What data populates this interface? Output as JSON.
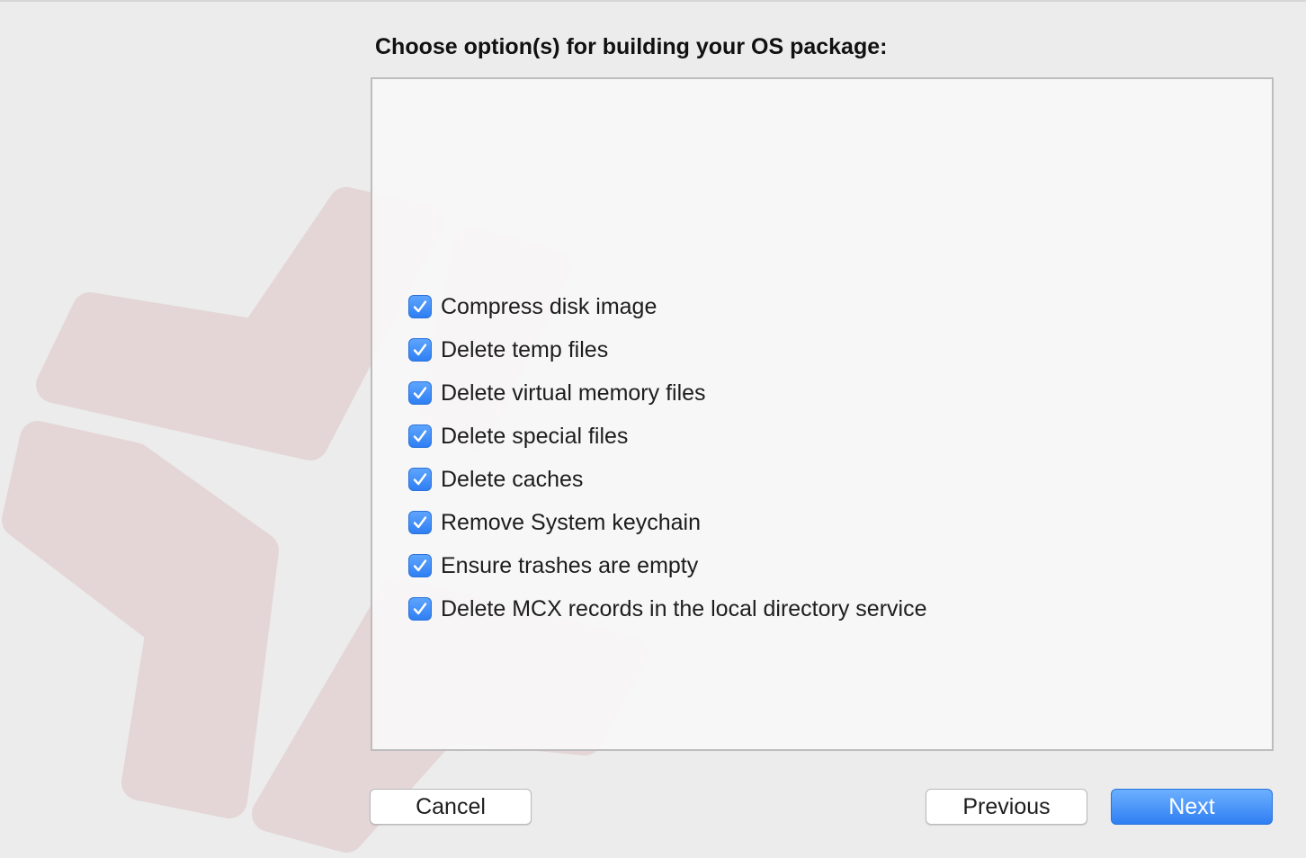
{
  "wizard": {
    "heading": "Choose option(s) for building your OS package:"
  },
  "options": [
    {
      "label": "Compress disk image",
      "checked": true
    },
    {
      "label": "Delete temp files",
      "checked": true
    },
    {
      "label": "Delete virtual memory files",
      "checked": true
    },
    {
      "label": "Delete special files",
      "checked": true
    },
    {
      "label": "Delete caches",
      "checked": true
    },
    {
      "label": "Remove System keychain",
      "checked": true
    },
    {
      "label": "Ensure trashes are empty",
      "checked": true
    },
    {
      "label": "Delete MCX records in the local directory service",
      "checked": true
    }
  ],
  "buttons": {
    "cancel": "Cancel",
    "previous": "Previous",
    "next": "Next"
  },
  "colors": {
    "accent": "#3b86f7",
    "logo": "#dcbcbc"
  },
  "icons": {
    "checkbox": "checkmark-icon",
    "background": "app-logo-watermark"
  }
}
